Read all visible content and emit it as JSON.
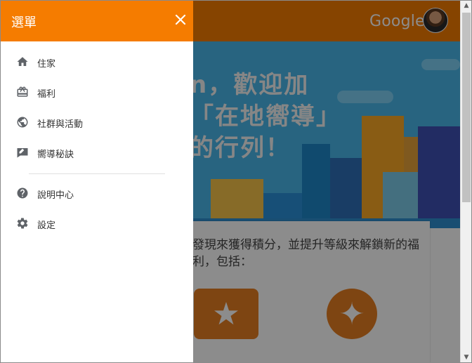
{
  "drawer": {
    "title": "選單",
    "close_symbol": "✕",
    "items": [
      {
        "label": "住家",
        "icon": "home-icon"
      },
      {
        "label": "福利",
        "icon": "gift-icon"
      },
      {
        "label": "社群與活動",
        "icon": "globe-icon"
      },
      {
        "label": "嚮導秘訣",
        "icon": "guide-icon"
      }
    ],
    "secondary_items": [
      {
        "label": "說明中心",
        "icon": "help-icon"
      },
      {
        "label": "設定",
        "icon": "gear-icon"
      }
    ]
  },
  "header": {
    "logo_text": "Google",
    "accent_color": "#f57c00"
  },
  "hero": {
    "welcome_text": "n，歡迎加「在地嚮導」的行列！"
  },
  "benefits": {
    "description": "發現來獲得積分，並提升等級來解鎖新的福利，包括："
  }
}
